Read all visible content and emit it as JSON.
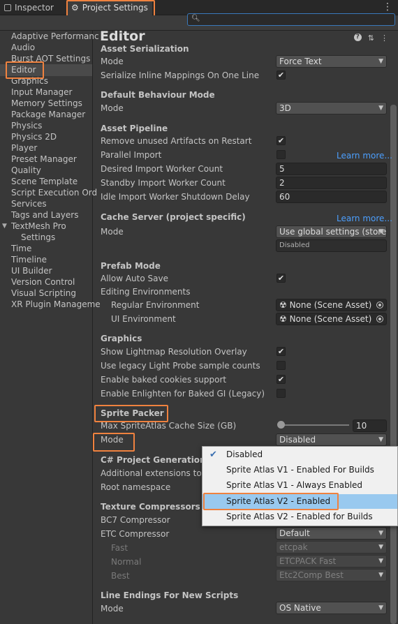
{
  "tabs": {
    "inspector": "Inspector",
    "project_settings": "Project Settings"
  },
  "sidebar": {
    "items": [
      {
        "label": "Adaptive Performanc"
      },
      {
        "label": "Audio"
      },
      {
        "label": "Burst AOT Settings"
      },
      {
        "label": "Editor"
      },
      {
        "label": "Graphics"
      },
      {
        "label": "Input Manager"
      },
      {
        "label": "Memory Settings"
      },
      {
        "label": "Package Manager"
      },
      {
        "label": "Physics"
      },
      {
        "label": "Physics 2D"
      },
      {
        "label": "Player"
      },
      {
        "label": "Preset Manager"
      },
      {
        "label": "Quality"
      },
      {
        "label": "Scene Template"
      },
      {
        "label": "Script Execution Ord"
      },
      {
        "label": "Services"
      },
      {
        "label": "Tags and Layers"
      },
      {
        "label": "TextMesh Pro"
      },
      {
        "label": "Settings"
      },
      {
        "label": "Time"
      },
      {
        "label": "Timeline"
      },
      {
        "label": "UI Builder"
      },
      {
        "label": "Version Control"
      },
      {
        "label": "Visual Scripting"
      },
      {
        "label": "XR Plugin Manageme"
      }
    ]
  },
  "main": {
    "title": "Editor",
    "asset_serialization": {
      "header": "Asset Serialization",
      "mode_label": "Mode",
      "mode_value": "Force Text",
      "inline_label": "Serialize Inline Mappings On One Line"
    },
    "default_behaviour": {
      "header": "Default Behaviour Mode",
      "mode_label": "Mode",
      "mode_value": "3D"
    },
    "asset_pipeline": {
      "header": "Asset Pipeline",
      "remove_unused": "Remove unused Artifacts on Restart",
      "parallel_import": "Parallel Import",
      "learn_more": "Learn more...",
      "desired_count_label": "Desired Import Worker Count",
      "desired_count": "5",
      "standby_count_label": "Standby Import Worker Count",
      "standby_count": "2",
      "idle_delay_label": "Idle Import Worker Shutdown Delay",
      "idle_delay": "60"
    },
    "cache_server": {
      "header": "Cache Server (project specific)",
      "learn_more": "Learn more...",
      "mode_label": "Mode",
      "mode_value": "Use global settings (store",
      "status": "Disabled"
    },
    "prefab_mode": {
      "header": "Prefab Mode",
      "allow_autosave": "Allow Auto Save",
      "editing_env": "Editing Environments",
      "regular_env_label": "Regular Environment",
      "regular_env_value": "None (Scene Asset)",
      "ui_env_label": "UI Environment",
      "ui_env_value": "None (Scene Asset)"
    },
    "graphics": {
      "header": "Graphics",
      "lightmap_overlay": "Show Lightmap Resolution Overlay",
      "legacy_probe": "Use legacy Light Probe sample counts",
      "baked_cookies": "Enable baked cookies support",
      "enlighten": "Enable Enlighten for Baked GI (Legacy)"
    },
    "sprite_packer": {
      "header": "Sprite Packer",
      "cache_size_label": "Max SpriteAtlas Cache Size (GB)",
      "cache_size": "10",
      "cache_size_fraction": 0.1,
      "mode_label": "Mode",
      "mode_value": "Disabled"
    },
    "csharp": {
      "header": "C# Project Generation",
      "extensions_label": "Additional extensions to in",
      "root_ns_label": "Root namespace"
    },
    "texture_compressors": {
      "header": "Texture Compressors",
      "bc7_label": "BC7 Compressor",
      "etc_label": "ETC Compressor",
      "etc_value": "Default",
      "fast_label": "Fast",
      "fast_value": "etcpak",
      "normal_label": "Normal",
      "normal_value": "ETCPACK Fast",
      "best_label": "Best",
      "best_value": "Etc2Comp Best"
    },
    "line_endings": {
      "header": "Line Endings For New Scripts",
      "mode_label": "Mode",
      "mode_value": "OS Native"
    }
  },
  "popup": {
    "options": [
      "Disabled",
      "Sprite Atlas V1 - Enabled For Builds",
      "Sprite Atlas V1 - Always Enabled",
      "Sprite Atlas V2 - Enabled",
      "Sprite Atlas V2 - Enabled for Builds"
    ]
  },
  "colors": {
    "highlight": "#f0823f",
    "link": "#4c9ffe",
    "popup_selected": "#99c9ef"
  }
}
